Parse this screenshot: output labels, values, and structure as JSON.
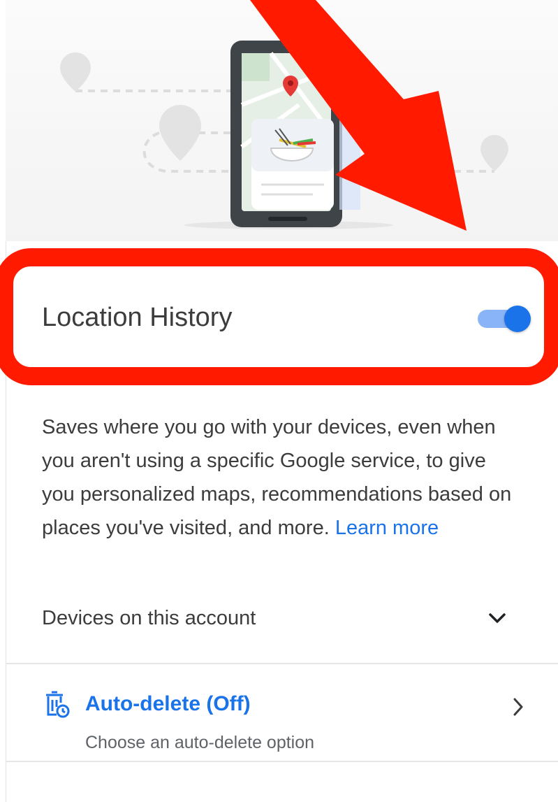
{
  "settings": {
    "location_history_label": "Location History",
    "location_history_enabled": true,
    "description_text": "Saves where you go with your devices, even when you aren't using a specific Google service, to give you personalized maps, recommendations based on places you've visited, and more.",
    "learn_more_label": "Learn more",
    "devices_label": "Devices on this account",
    "auto_delete_title": "Auto-delete (Off)",
    "auto_delete_subtitle": "Choose an auto-delete option"
  },
  "icons": {
    "devices_expand": "chevron-down-icon",
    "auto_delete": "auto-delete-icon",
    "auto_delete_open": "chevron-right-icon"
  },
  "colors": {
    "accent": "#1a73e8",
    "toggle_track": "#8ab4f8",
    "annotation_red": "#ff1a00",
    "text": "#3c3c3c"
  }
}
